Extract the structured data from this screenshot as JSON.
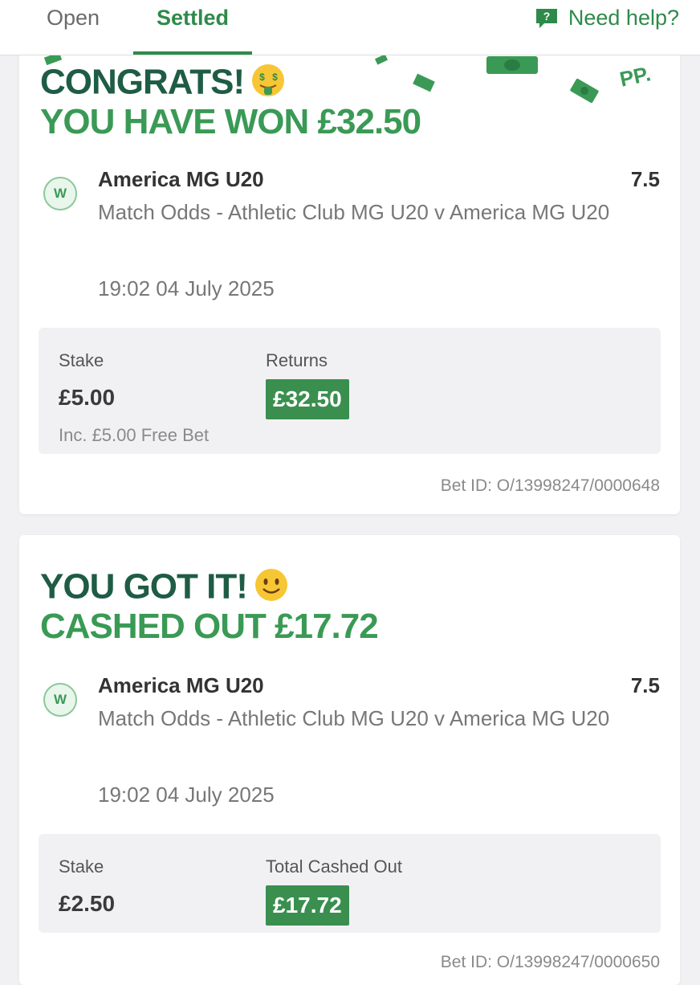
{
  "tabs": {
    "open": "Open",
    "settled": "Settled"
  },
  "help": {
    "label": "Need help?"
  },
  "bets": [
    {
      "headline_top": "CONGRATS!",
      "headline_bottom": "YOU HAVE WON £32.50",
      "decoration_text": "PP.",
      "badge": "W",
      "selection": "America MG U20",
      "odds": "7.5",
      "market": "Match Odds - Athletic Club MG U20 v America MG U20",
      "date": "19:02 04 July 2025",
      "stake_label": "Stake",
      "stake": "£5.00",
      "stake_note": "Inc. £5.00 Free Bet",
      "returns_label": "Returns",
      "returns": "£32.50",
      "bet_id": "Bet ID: O/13998247/0000648"
    },
    {
      "headline_top": "YOU GOT IT!",
      "headline_bottom": "CASHED OUT £17.72",
      "badge": "W",
      "selection": "America MG U20",
      "odds": "7.5",
      "market": "Match Odds - Athletic Club MG U20 v America MG U20",
      "date": "19:02 04 July 2025",
      "stake_label": "Stake",
      "stake": "£2.50",
      "returns_label": "Total Cashed Out",
      "returns": "£17.72",
      "bet_id": "Bet ID: O/13998247/0000650"
    }
  ],
  "colors": {
    "brand_green": "#2e8a4a",
    "headline_dark": "#1f5c45",
    "headline_green": "#3a9a55",
    "pill_green": "#3a8f4f"
  }
}
